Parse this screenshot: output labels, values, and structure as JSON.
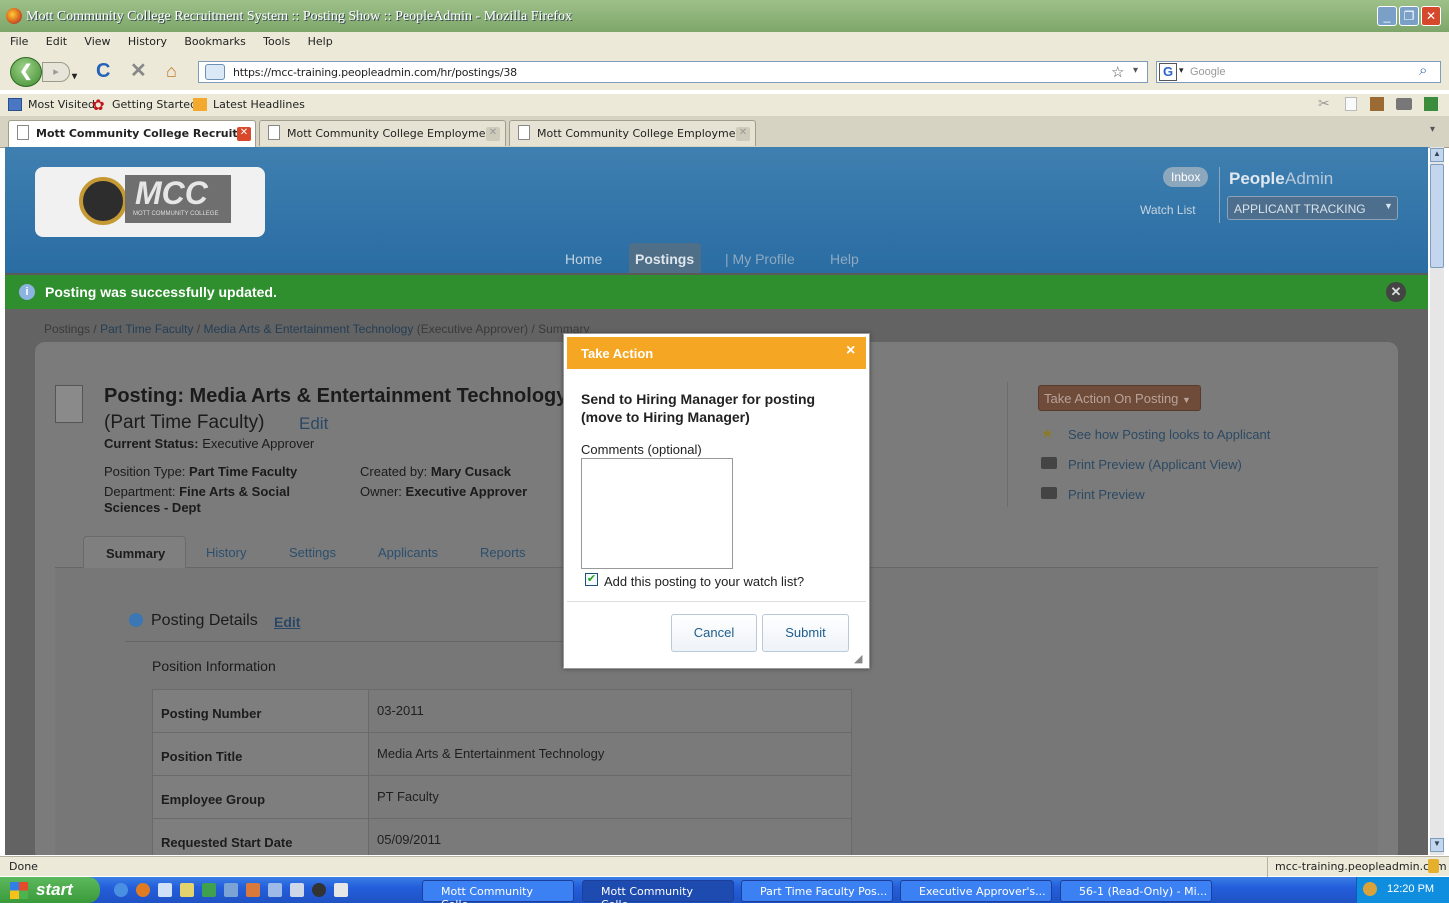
{
  "window": {
    "title": "Mott Community College Recruitment System :: Posting Show :: PeopleAdmin - Mozilla Firefox"
  },
  "menu": [
    "File",
    "Edit",
    "View",
    "History",
    "Bookmarks",
    "Tools",
    "Help"
  ],
  "toolbar": {
    "url": "https://mcc-training.peopleadmin.com/hr/postings/38",
    "search_placeholder": "Google"
  },
  "bookmarks": [
    "Most Visited",
    "Getting Started",
    "Latest Headlines"
  ],
  "tabs": [
    {
      "label": "Mott Community College Recruit..."
    },
    {
      "label": "Mott Community College Employment"
    },
    {
      "label": "Mott Community College Employment"
    }
  ],
  "site": {
    "logo_text": "MCC",
    "logo_sub": "MOTT COMMUNITY COLLEGE",
    "inbox": "Inbox",
    "brand_a": "People",
    "brand_b": "Admin",
    "watch_list": "Watch List",
    "module": "APPLICANT TRACKING",
    "nav": [
      "Home",
      "Postings",
      "| My Profile",
      "Help"
    ]
  },
  "flash": "Posting was successfully updated.",
  "breadcrumb": {
    "root": "Postings",
    "sep": "/",
    "item1": "Part Time Faculty",
    "item2": "Media Arts & Entertainment Technology",
    "item2_note": "(Executive Approver)",
    "current": "Summary"
  },
  "posting": {
    "title": "Posting: Media Arts & Entertainment Technology",
    "subtitle": "(Part Time Faculty)",
    "edit": "Edit",
    "status_label": "Current Status:",
    "status_value": "Executive Approver",
    "position_type_label": "Position Type:",
    "position_type": "Part Time Faculty",
    "department_label": "Department:",
    "department": "Fine Arts & Social",
    "department2": "Sciences - Dept",
    "created_label": "Created by:",
    "created_by": "Mary Cusack",
    "owner_label": "Owner:",
    "owner": "Executive Approver"
  },
  "actions": {
    "take_action": "Take Action On Posting",
    "see_how": "See how Posting looks to Applicant",
    "print_preview_applicant": "Print Preview (Applicant View)",
    "print_preview": "Print Preview"
  },
  "page_tabs": [
    "Summary",
    "History",
    "Settings",
    "Applicants",
    "Reports"
  ],
  "details": {
    "heading": "Posting Details",
    "edit": "Edit",
    "section": "Position Information",
    "rows": [
      {
        "label": "Posting Number",
        "value": "03-2011"
      },
      {
        "label": "Position Title",
        "value": "Media Arts & Entertainment Technology"
      },
      {
        "label": "Employee Group",
        "value": "PT Faculty"
      },
      {
        "label": "Requested Start Date",
        "value": "05/09/2011"
      }
    ]
  },
  "modal": {
    "title": "Take Action",
    "close": "×",
    "message": "Send to Hiring Manager for posting (move to Hiring Manager)",
    "comments_label": "Comments (optional)",
    "watch_label": "Add this posting to your watch list?",
    "watch_checked": true,
    "cancel": "Cancel",
    "submit": "Submit"
  },
  "status": {
    "left": "Done",
    "right": "mcc-training.peopleadmin.com"
  },
  "taskbar": {
    "start": "start",
    "tasks": [
      "Mott Community Colle...",
      "Mott Community Colle...",
      "Part Time Faculty Pos...",
      "Executive Approver's...",
      "56-1 (Read-Only) - Mi..."
    ],
    "clock": "12:20 PM"
  },
  "colors": {
    "header": "#2a6da3",
    "flash": "#2f8f2f",
    "modal_header": "#f5a623",
    "action_button": "#c0552a"
  }
}
